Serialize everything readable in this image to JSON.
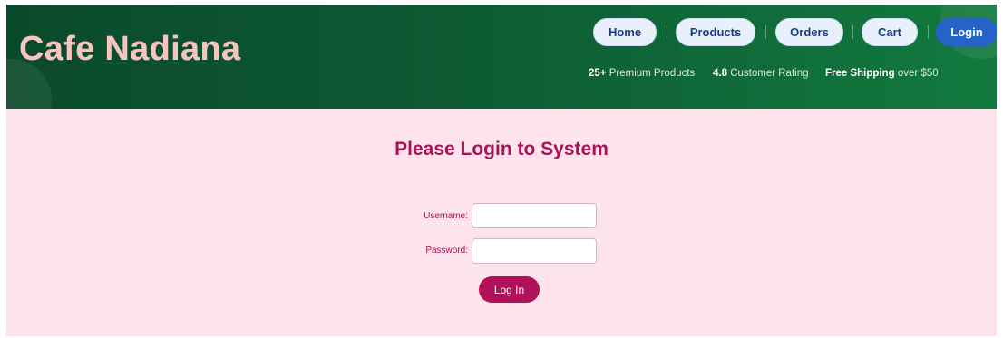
{
  "brand": {
    "title": "Cafe Nadiana"
  },
  "nav": {
    "items": [
      {
        "label": "Home"
      },
      {
        "label": "Products"
      },
      {
        "label": "Orders"
      },
      {
        "label": "Cart"
      },
      {
        "label": "Login",
        "active": true
      }
    ]
  },
  "stats": {
    "products": {
      "value": "25+",
      "label": "Premium Products"
    },
    "rating": {
      "value": "4.8",
      "label": "Customer Rating"
    },
    "shipping": {
      "value": "Free Shipping",
      "label": "over $50"
    }
  },
  "login": {
    "title": "Please Login to System",
    "username_label": "Username:",
    "username_value": "",
    "password_label": "Password:",
    "password_value": "",
    "submit_label": "Log In"
  },
  "colors": {
    "header_green": "#0d5a33",
    "brand_pink": "#f7c4c0",
    "accent_magenta": "#a81257",
    "content_bg": "#fde4ec",
    "nav_active": "#2563c9"
  }
}
